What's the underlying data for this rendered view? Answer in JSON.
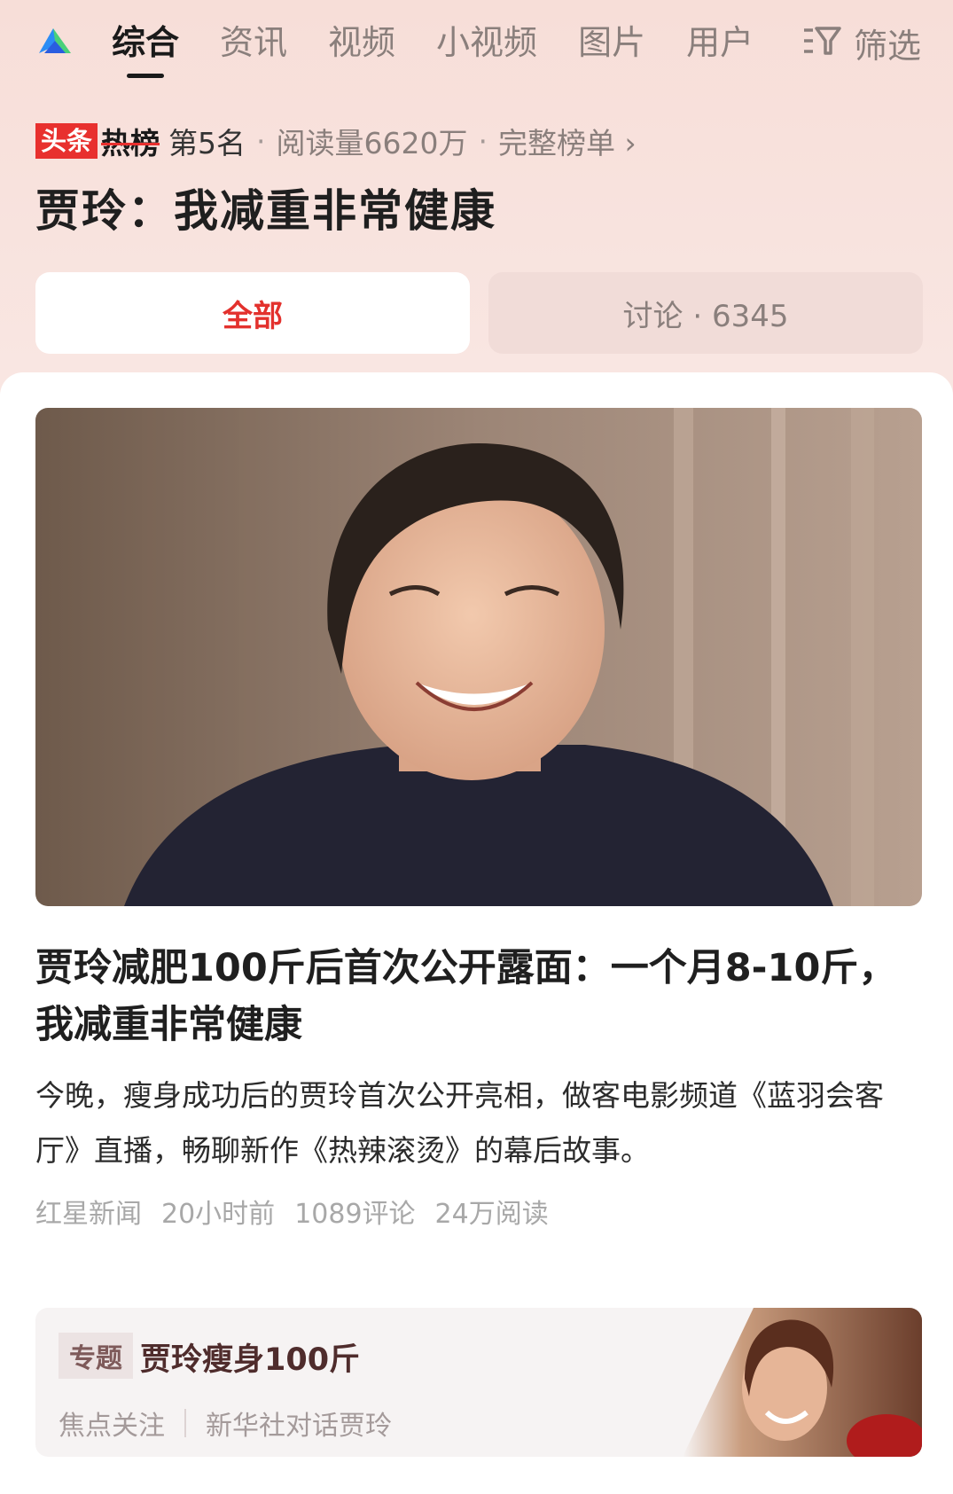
{
  "nav": {
    "tabs": [
      "综合",
      "资讯",
      "视频",
      "小视频",
      "图片",
      "用户"
    ],
    "active_tab": "综合",
    "filter_label": "筛选"
  },
  "hotlist": {
    "badge_left": "头条",
    "badge_right": "热榜",
    "rank": "第5名",
    "reads": "阅读量6620万",
    "full_list": "完整榜单 ›"
  },
  "topic_headline": "贾玲：我减重非常健康",
  "segments": {
    "all": "全部",
    "discussion": "讨论 · 6345"
  },
  "article": {
    "title": "贾玲减肥100斤后首次公开露面：一个月8-10斤，我减重非常健康",
    "summary": "今晚，瘦身成功后的贾玲首次公开亮相，做客电影频道《蓝羽会客厅》直播，畅聊新作《热辣滚烫》的幕后故事。",
    "source": "红星新闻",
    "time": "20小时前",
    "comments": "1089评论",
    "reads": "24万阅读"
  },
  "special_topic": {
    "tag": "专题",
    "title": "贾玲瘦身100斤",
    "link1": "焦点关注",
    "link2": "新华社对话贾玲"
  },
  "colors": {
    "accent_red": "#e3312d",
    "badge_red": "#e8302e",
    "muted_text": "#8a7f7c"
  }
}
